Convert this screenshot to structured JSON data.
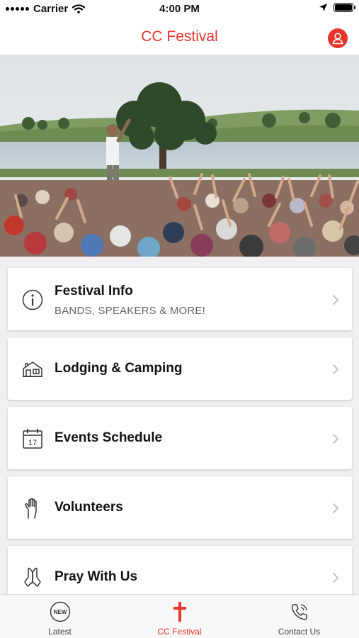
{
  "status_bar": {
    "carrier": "Carrier",
    "time": "4:00 PM"
  },
  "nav": {
    "title": "CC Festival"
  },
  "menu": [
    {
      "title": "Festival Info",
      "subtitle": "BANDS, SPEAKERS & MORE!",
      "icon": "info-icon"
    },
    {
      "title": "Lodging & Camping",
      "icon": "house-icon"
    },
    {
      "title": "Events Schedule",
      "icon": "calendar-icon",
      "calendar_day": "17"
    },
    {
      "title": "Volunteers",
      "icon": "raised-hand-icon"
    },
    {
      "title": "Pray With Us",
      "icon": "praying-hands-icon"
    }
  ],
  "tabs": [
    {
      "label": "Latest",
      "icon": "new-badge-icon",
      "badge_text": "NEW"
    },
    {
      "label": "CC Festival",
      "icon": "cross-icon",
      "active": true
    },
    {
      "label": "Contact Us",
      "icon": "phone-icon"
    }
  ],
  "colors": {
    "accent": "#e8352b",
    "background": "#f0f0f2",
    "card": "#ffffff"
  }
}
